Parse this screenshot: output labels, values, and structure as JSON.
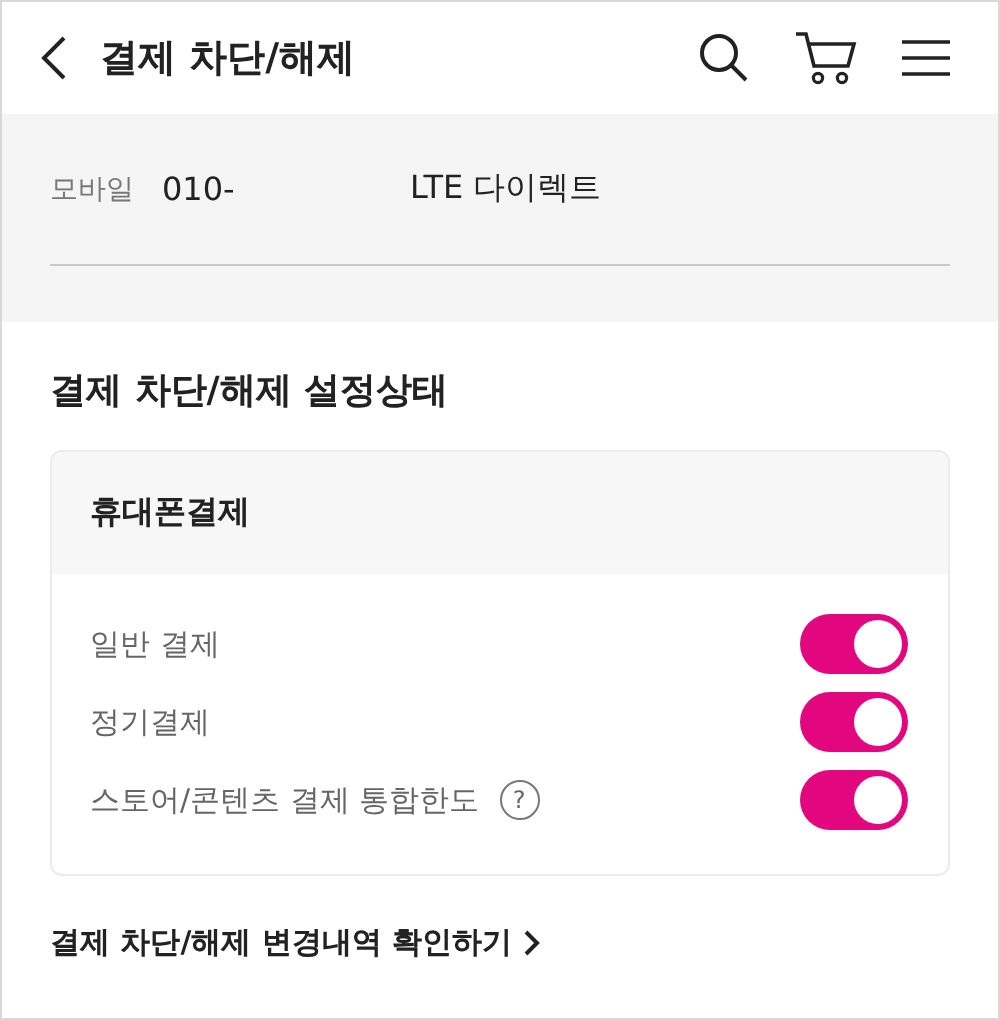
{
  "header": {
    "title": "결제 차단/해제"
  },
  "line": {
    "label": "모바일",
    "number": "010-",
    "plan": "LTE 다이렉트"
  },
  "section": {
    "title": "결제 차단/해제 설정상태"
  },
  "card": {
    "title": "휴대폰결제",
    "items": [
      {
        "label": "일반 결제",
        "on": true
      },
      {
        "label": "정기결제",
        "on": true
      },
      {
        "label": "스토어/콘텐츠 결제 통합한도",
        "on": true,
        "help": "?"
      }
    ]
  },
  "link": {
    "label": "결제 차단/해제 변경내역 확인하기"
  }
}
